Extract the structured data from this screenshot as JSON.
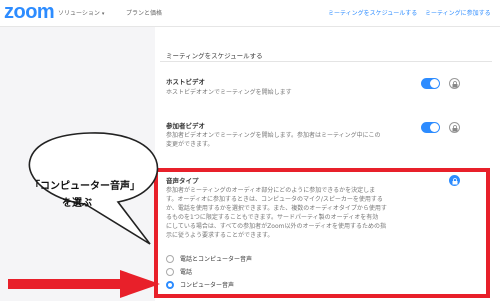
{
  "header": {
    "logo": "zoom",
    "nav": [
      {
        "label": "ソリューション",
        "caret": "▾"
      },
      {
        "label": "プランと価格"
      }
    ],
    "right_links": [
      "ミーティングをスケジュールする",
      "ミーティングに参加する"
    ]
  },
  "main": {
    "section_title": "ミーティングをスケジュールする",
    "settings": [
      {
        "title": "ホストビデオ",
        "desc": [
          "ホストビデオオンでミーティングを開始します"
        ],
        "toggle_on": true
      },
      {
        "title": "参加者ビデオ",
        "desc": [
          "参加者ビデオオンでミーティングを開始します。参加者はミーティング中にこの",
          "変更ができます。"
        ],
        "toggle_on": true
      }
    ],
    "audio": {
      "title": "音声タイプ",
      "desc": [
        "参加者がミーティングのオーディオ部分にどのように参加できるかを決定しま",
        "す。オーディオに参加するときは、コンピュータのマイク/スピーカーを使用する",
        "か、電話を使用するかを選択できます。また、複数のオーディオタイプから使用す",
        "るものを1つに限定することもできます。サードパーティ製のオーディオを有効",
        "にしている場合は、すべての参加者がZoom以外のオーディオを使用するための指",
        "示に従うよう要求することができます。"
      ],
      "options": [
        "電話とコンピューター音声",
        "電話",
        "コンピューター音声"
      ],
      "selected_index": 2
    }
  },
  "annotation": {
    "callout_lines": [
      "「コンピューター音声」",
      "を選ぶ"
    ],
    "color": "#e8202a"
  },
  "colors": {
    "accent": "#2d8cff",
    "highlight": "#e8202a"
  }
}
